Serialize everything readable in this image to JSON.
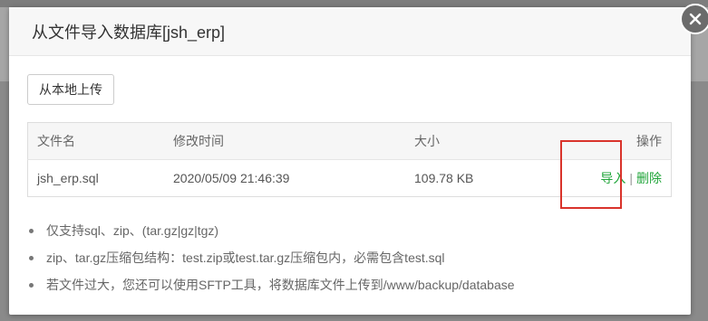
{
  "dialog": {
    "title": "从文件导入数据库[jsh_erp]",
    "upload_button": "从本地上传"
  },
  "table": {
    "headers": [
      "文件名",
      "修改时间",
      "大小",
      "操作"
    ],
    "rows": [
      {
        "name": "jsh_erp.sql",
        "mtime": "2020/05/09 21:46:39",
        "size": "109.78 KB",
        "op_import": "导入",
        "op_sep": "|",
        "op_delete": "删除"
      }
    ]
  },
  "notes": [
    "仅支持sql、zip、(tar.gz|gz|tgz)",
    "zip、tar.gz压缩包结构：test.zip或test.tar.gz压缩包内，必需包含test.sql",
    "若文件过大，您还可以使用SFTP工具，将数据库文件上传到/www/backup/database"
  ],
  "icons": {
    "close": "close-icon"
  },
  "colors": {
    "link": "#20a53a",
    "highlight": "#d9332b"
  }
}
